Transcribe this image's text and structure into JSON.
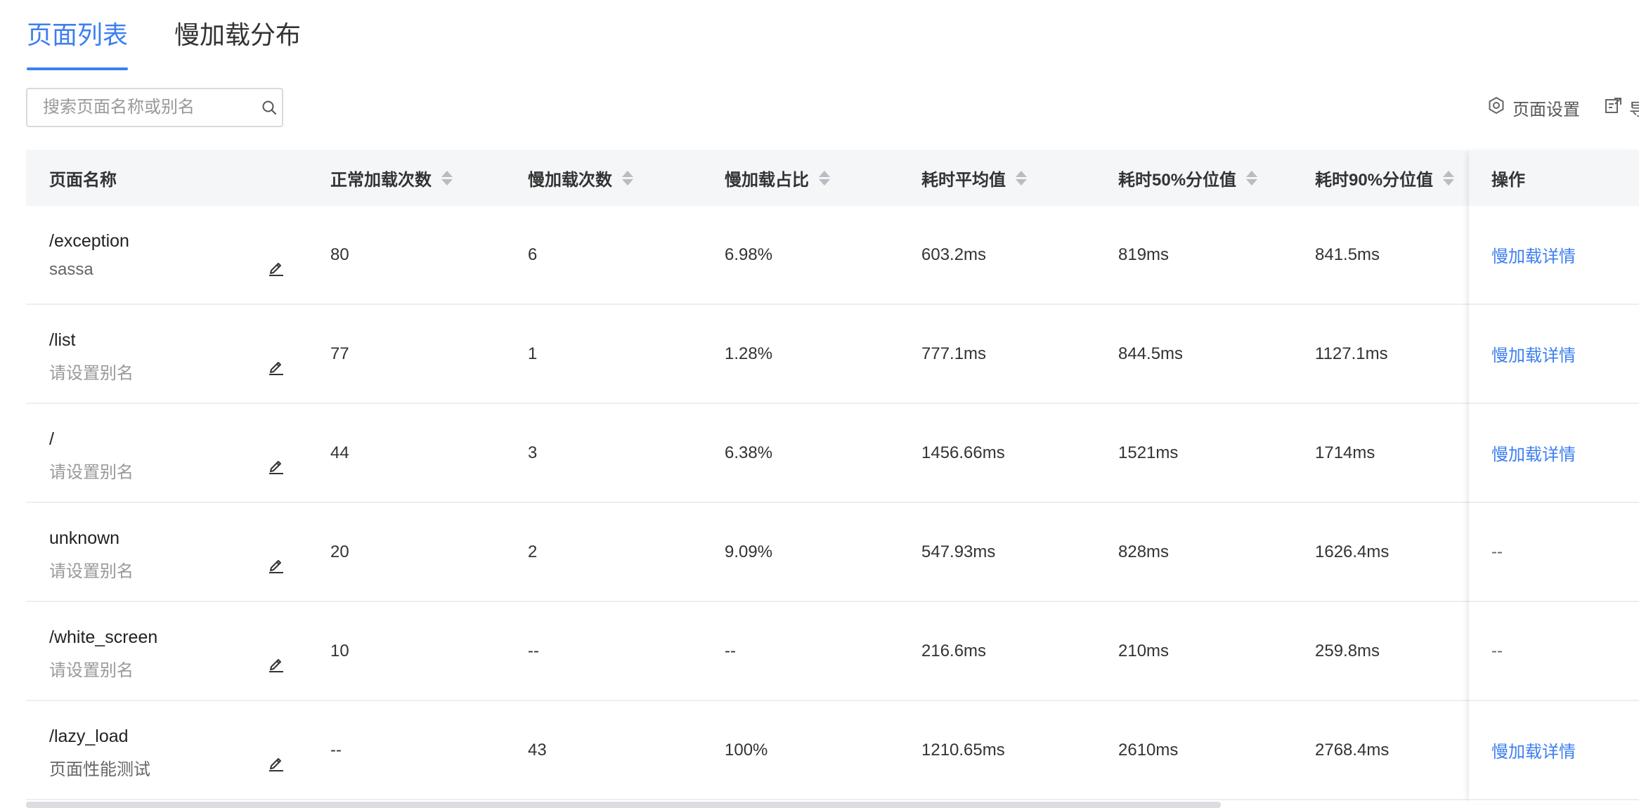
{
  "tabs": [
    {
      "label": "页面列表",
      "active": true
    },
    {
      "label": "慢加载分布",
      "active": false
    }
  ],
  "search": {
    "placeholder": "搜索页面名称或别名"
  },
  "toolbar": {
    "page_settings": "页面设置",
    "export": "导"
  },
  "colors": {
    "accent": "#3d7ff0",
    "header_bg": "#f4f6f8"
  },
  "table": {
    "columns": [
      "页面名称",
      "正常加载次数",
      "慢加载次数",
      "慢加载占比",
      "耗时平均值",
      "耗时50%分位值",
      "耗时90%分位值",
      "操作"
    ],
    "rows": [
      {
        "name": "/exception",
        "alias": "sassa",
        "alias_set": true,
        "normal": "80",
        "slow": "6",
        "ratio": "6.98%",
        "avg": "603.2ms",
        "p50": "819ms",
        "p90": "841.5ms",
        "action": "慢加载详情",
        "action_link": true
      },
      {
        "name": "/list",
        "alias": "请设置别名",
        "alias_set": false,
        "normal": "77",
        "slow": "1",
        "ratio": "1.28%",
        "avg": "777.1ms",
        "p50": "844.5ms",
        "p90": "1127.1ms",
        "action": "慢加载详情",
        "action_link": true
      },
      {
        "name": "/",
        "alias": "请设置别名",
        "alias_set": false,
        "normal": "44",
        "slow": "3",
        "ratio": "6.38%",
        "avg": "1456.66ms",
        "p50": "1521ms",
        "p90": "1714ms",
        "action": "慢加载详情",
        "action_link": true
      },
      {
        "name": "unknown",
        "alias": "请设置别名",
        "alias_set": false,
        "normal": "20",
        "slow": "2",
        "ratio": "9.09%",
        "avg": "547.93ms",
        "p50": "828ms",
        "p90": "1626.4ms",
        "action": "--",
        "action_link": false
      },
      {
        "name": "/white_screen",
        "alias": "请设置别名",
        "alias_set": false,
        "normal": "10",
        "slow": "--",
        "ratio": "--",
        "avg": "216.6ms",
        "p50": "210ms",
        "p90": "259.8ms",
        "action": "--",
        "action_link": false
      },
      {
        "name": "/lazy_load",
        "alias": "页面性能测试",
        "alias_set": true,
        "normal": "--",
        "slow": "43",
        "ratio": "100%",
        "avg": "1210.65ms",
        "p50": "2610ms",
        "p90": "2768.4ms",
        "action": "慢加载详情",
        "action_link": true
      }
    ]
  }
}
